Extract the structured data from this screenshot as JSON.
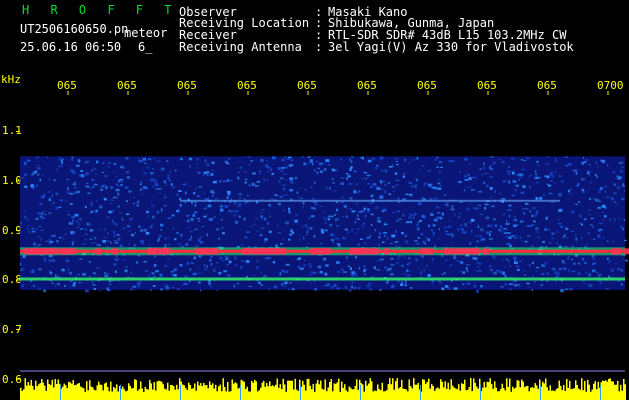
{
  "header": {
    "logo_text": "H R O F F T",
    "filename": "UT2506160650.pn",
    "type_label": "meteor",
    "datetime": "25.06.16 06:50",
    "extra": "6_",
    "fields": [
      {
        "label": "Observer",
        "sep": ":",
        "value": "Masaki Kano"
      },
      {
        "label": "Receiving Location",
        "sep": ":",
        "value": "Shibukawa, Gunma, Japan"
      },
      {
        "label": "Receiver",
        "sep": ":",
        "value": "RTL-SDR SDR# 43dB L15 103.2MHz CW"
      },
      {
        "label": "Receiving Antenna",
        "sep": ":",
        "value": "3el Yagi(V) Az 330 for Vladivostok"
      }
    ]
  },
  "spectrogram": {
    "freq_unit": "kHz",
    "time_ticks": [
      "065",
      "065",
      "065",
      "065",
      "065",
      "065",
      "065",
      "065",
      "065",
      "0700"
    ],
    "freq_ticks": [
      "1.1",
      "1.0",
      "0.9",
      "0.8",
      "0.7",
      "0.6"
    ],
    "freq_tick_values": [
      1.1,
      1.0,
      0.9,
      0.8,
      0.7,
      0.6
    ],
    "freq_range": [
      0.6,
      1.2
    ],
    "noise_band_range": [
      0.78,
      1.05
    ],
    "carrier_lines_khz": [
      0.858,
      0.802,
      0.96
    ],
    "colors": {
      "background": "#000000",
      "labels": "#ffff00",
      "text": "#ffffff",
      "logo": "#00dd33",
      "noise_low": "#0a1a8c",
      "noise_high": "#2a8cff",
      "carrier": "#ff2a3a",
      "carrier_glow": "#33ff66",
      "level_bar": "#ffff00",
      "frame": "#8888ff"
    }
  }
}
